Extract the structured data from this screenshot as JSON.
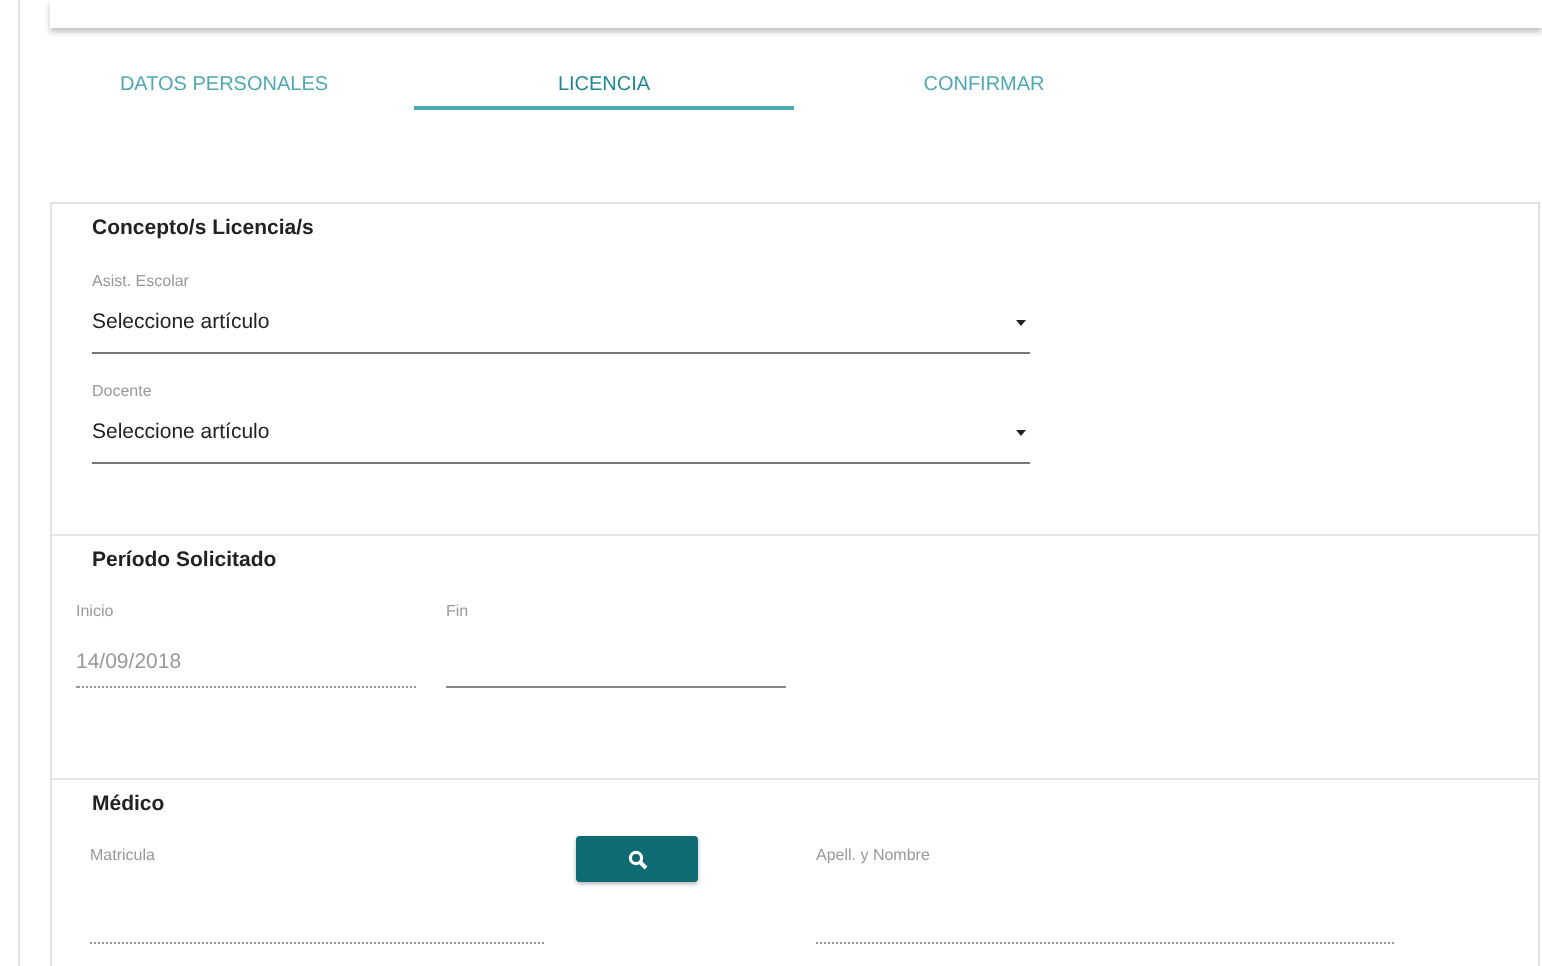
{
  "tabs": [
    {
      "label": "DATOS PERSONALES",
      "selected": false
    },
    {
      "label": "LICENCIA",
      "selected": true
    },
    {
      "label": "CONFIRMAR",
      "selected": false
    }
  ],
  "sections": [
    {
      "title": "Concepto/s Licencia/s",
      "selects": [
        {
          "label": "Asist. Escolar",
          "value": "Seleccione artículo"
        },
        {
          "label": "Docente",
          "value": "Seleccione artículo"
        }
      ]
    },
    {
      "title": "Período Solicitado",
      "fields": [
        {
          "label": "Inicio",
          "value": "14/09/2018",
          "disabled": true
        },
        {
          "label": "Fin",
          "disabled": false
        }
      ]
    },
    {
      "title": "Médico",
      "fields": [
        {
          "label": "Matricula",
          "disabled": true
        },
        {
          "kind": "search-button"
        },
        {
          "label": "Apell. y Nombre",
          "disabled": true
        }
      ]
    }
  ]
}
